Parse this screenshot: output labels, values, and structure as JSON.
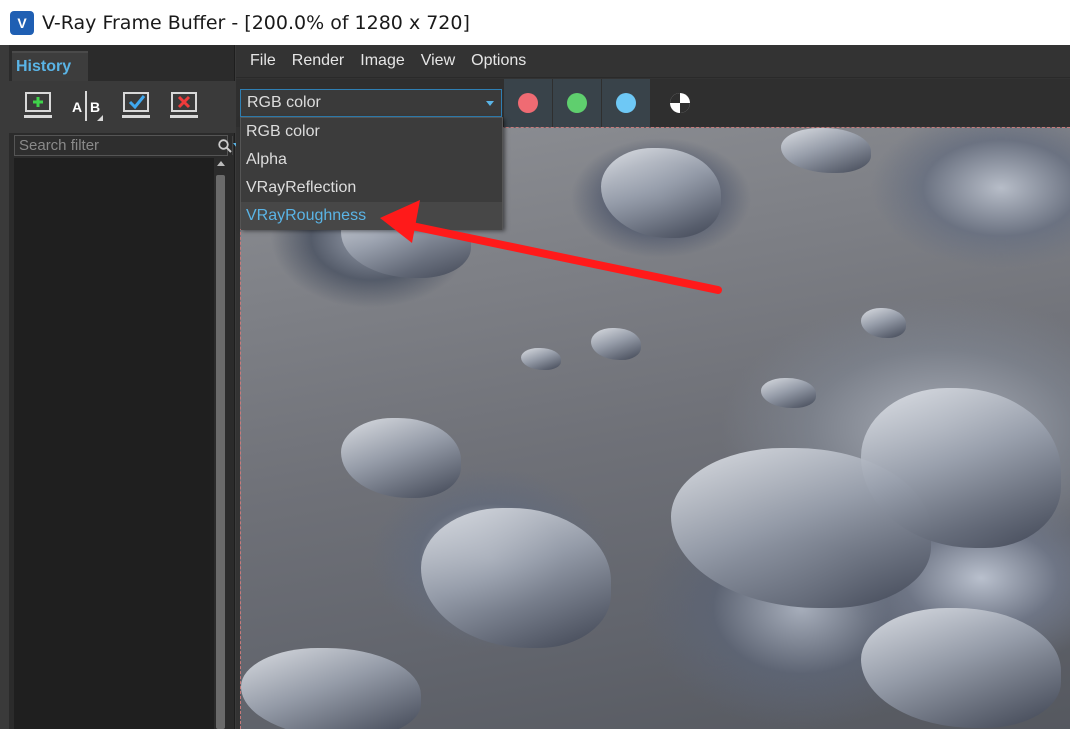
{
  "window": {
    "title": "V-Ray Frame Buffer - [200.0% of 1280 x 720]",
    "icon": "vray-logo-icon",
    "icon_letter": "V"
  },
  "history": {
    "tab_label": "History",
    "toolbar_icons": [
      "save-to-history-icon",
      "ab-compare-icon",
      "load-from-history-icon",
      "clear-history-icon"
    ],
    "ab_label_a": "A",
    "ab_label_b": "B",
    "search_placeholder": "Search filter"
  },
  "menu": {
    "items": [
      "File",
      "Render",
      "Image",
      "View",
      "Options"
    ]
  },
  "channels": {
    "selected": "RGB color",
    "options": [
      "RGB color",
      "Alpha",
      "VRayReflection",
      "VRayRoughness"
    ],
    "highlighted_option": "VRayRoughness",
    "color_buttons": [
      {
        "name": "red-channel-button",
        "color": "#ef6b73"
      },
      {
        "name": "green-channel-button",
        "color": "#5fcf6e"
      },
      {
        "name": "blue-channel-button",
        "color": "#6ec8f5"
      }
    ],
    "mono_icon": "monochrome-icon"
  },
  "colors": {
    "accent": "#5ab4e6",
    "annotation_arrow": "#ff1a1a",
    "panel_bg": "#2b2b2b",
    "window_bg": "#333333"
  },
  "annotation": {
    "type": "arrow",
    "points_to": "VRayRoughness"
  }
}
